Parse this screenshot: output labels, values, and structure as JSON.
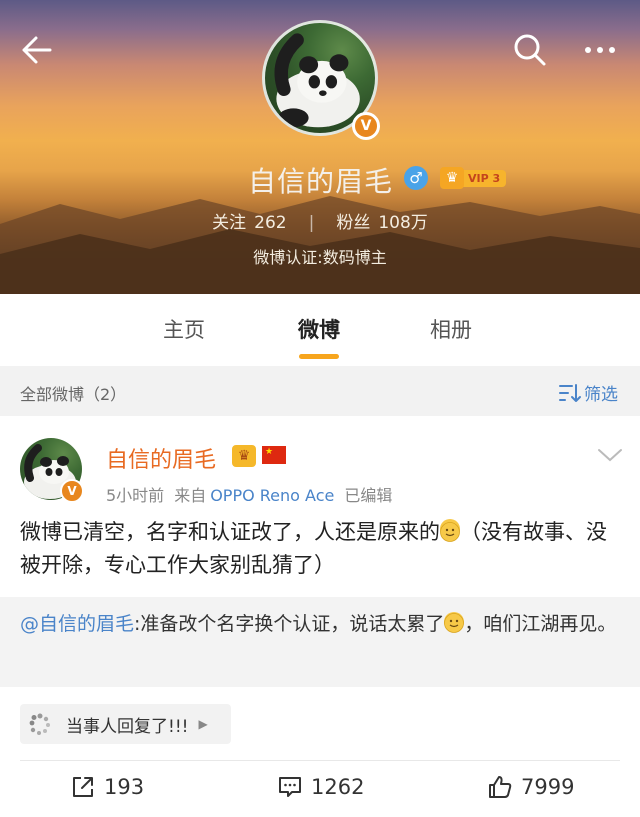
{
  "profile": {
    "name": "自信的眉毛",
    "vip_label": "VIP 3",
    "following_label": "关注",
    "following_count": "262",
    "followers_label": "粉丝",
    "followers_count": "108万",
    "verification": "微博认证:数码博主"
  },
  "tabs": [
    {
      "label": "主页",
      "active": false
    },
    {
      "label": "微博",
      "active": true
    },
    {
      "label": "相册",
      "active": false
    }
  ],
  "filter_bar": {
    "title": "全部微博（2）",
    "filter_label": "筛选"
  },
  "post": {
    "author": "自信的眉毛",
    "time": "5小时前",
    "source_prefix": "来自",
    "source": "OPPO Reno Ace",
    "edited": "已编辑",
    "text_part1": "微博已清空，名字和认证改了，人还是原来的",
    "text_part2": "（没有故事、没被开除，专心工作大家别乱猜了）",
    "quote_mention": "@自信的眉毛",
    "quote_part1": ":准备改个名字换个认证，说话太累了",
    "quote_part2": "，咱们江湖再见。",
    "reply_chip": "当事人回复了!!!",
    "reposts": "193",
    "comments": "1262",
    "likes": "7999"
  },
  "colors": {
    "accent_orange": "#f7a51d",
    "link_blue": "#4a84c9",
    "author_orange": "#e86a22"
  },
  "icons": [
    "back-icon",
    "search-icon",
    "more-icon",
    "verified-v-icon",
    "male-icon",
    "vip-crown-icon",
    "china-flag-icon",
    "chevron-down-icon",
    "sort-icon",
    "smile-emoji-icon",
    "spinner-icon",
    "repost-icon",
    "comment-icon",
    "like-icon"
  ]
}
